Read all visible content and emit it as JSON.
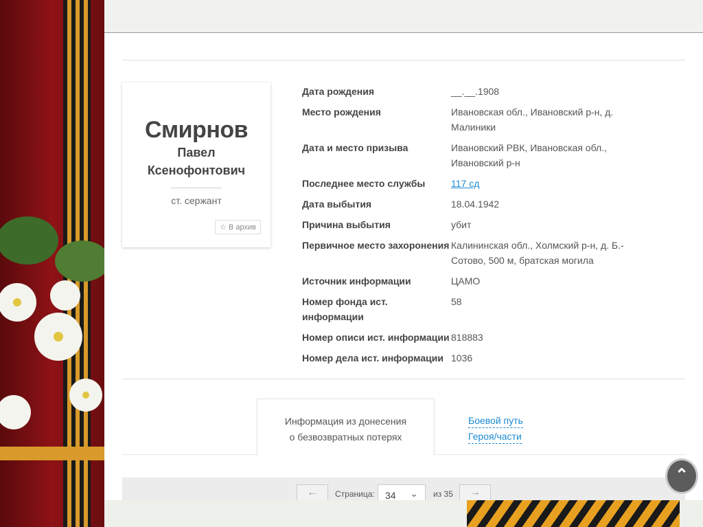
{
  "person": {
    "surname": "Смирнов",
    "first_name": "Павел",
    "patronymic": "Ксенофонтович",
    "rank": "ст. сержант",
    "archive_button": "В архив"
  },
  "details": [
    {
      "label": "Дата рождения",
      "value": "__.__.1908"
    },
    {
      "label": "Место рождения",
      "value": "Ивановская обл., Ивановский р-н, д. Малиники"
    },
    {
      "label": "Дата и место призыва",
      "value": "Ивановский РВК, Ивановская обл., Ивановский р-н"
    },
    {
      "label": "Последнее место службы",
      "value": "117 сд",
      "link": true
    },
    {
      "label": "Дата выбытия",
      "value": "18.04.1942"
    },
    {
      "label": "Причина выбытия",
      "value": "убит"
    },
    {
      "label": "Первичное место захоронения",
      "value": "Калининская обл., Холмский р-н, д. Б.-Сотово, 500 м, братская могила"
    },
    {
      "label": "Источник информации",
      "value": "ЦАМО"
    },
    {
      "label": "Номер фонда ист. информации",
      "value": "58"
    },
    {
      "label": "Номер описи ист. информации",
      "value": "818883"
    },
    {
      "label": "Номер дела ист. информации",
      "value": "1036"
    }
  ],
  "tabs": {
    "active_line1": "Информация из донесения",
    "active_line2": "о безвозвратных потерях",
    "link_line1": "Боевой путь",
    "link_line2": "Героя/части"
  },
  "pager": {
    "prev": "←",
    "label": "Страница:",
    "current": "34",
    "of": "из 35",
    "next": "→"
  },
  "scroll_top": "⌃"
}
